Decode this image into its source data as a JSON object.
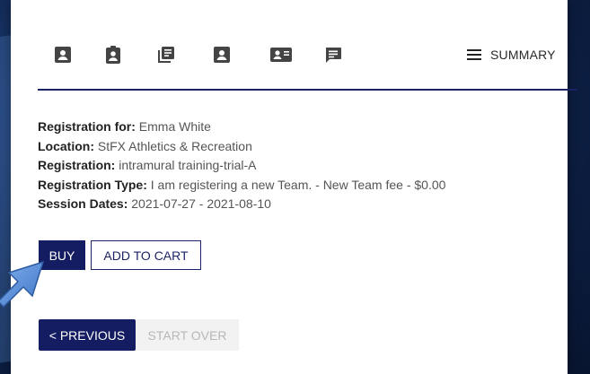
{
  "steps": {
    "icons": [
      "contact-card-icon",
      "clipboard-person-icon",
      "documents-icon",
      "profile-card-icon",
      "contact-group-icon",
      "comment-icon"
    ],
    "summary_label": "SUMMARY"
  },
  "registration": {
    "rows": [
      {
        "label": "Registration for:",
        "value": "Emma White"
      },
      {
        "label": "Location:",
        "value": "StFX Athletics & Recreation"
      },
      {
        "label": "Registration:",
        "value": "intramural training-trial-A"
      },
      {
        "label": "Registration Type:",
        "value": "I am registering a new Team. - New Team fee - $0.00"
      },
      {
        "label": "Session Dates:",
        "value": "2021-07-27 - 2021-08-10"
      }
    ]
  },
  "actions": {
    "buy_label": "BUY",
    "add_to_cart_label": "ADD TO CART"
  },
  "nav": {
    "previous_label": "< PREVIOUS",
    "start_over_label": "START OVER"
  },
  "colors": {
    "accent": "#141c62",
    "arrow": "#5b8fd6",
    "disabled_text": "#b7b7b7"
  }
}
